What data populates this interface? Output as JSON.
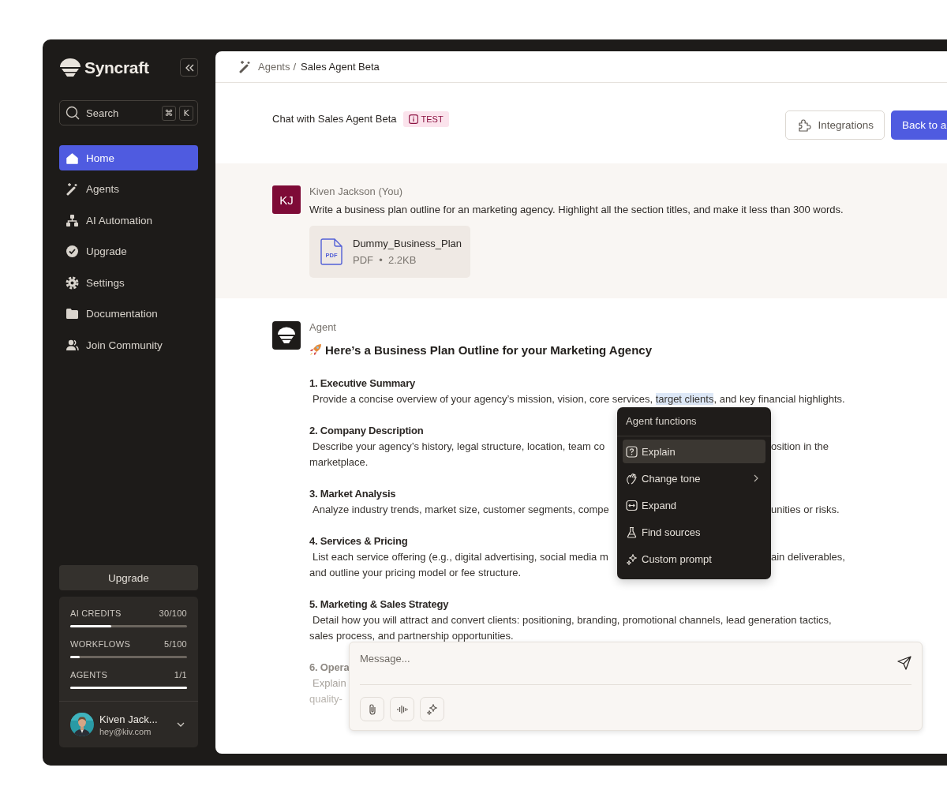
{
  "sidebar": {
    "brand": "Syncraft",
    "search": {
      "placeholder": "Search",
      "shortcut_keys": [
        "⌘",
        "K"
      ]
    },
    "nav": [
      {
        "label": "Home",
        "selected": true
      },
      {
        "label": "Agents",
        "selected": false
      },
      {
        "label": "AI Automation",
        "selected": false
      },
      {
        "label": "Upgrade",
        "selected": false
      },
      {
        "label": "Settings",
        "selected": false
      },
      {
        "label": "Documentation",
        "selected": false
      },
      {
        "label": "Join Community",
        "selected": false
      }
    ],
    "upgrade_button": "Upgrade",
    "usage": [
      {
        "label": "AI CREDITS",
        "value": "30/100",
        "level": 0.35
      },
      {
        "label": "WORKFLOWS",
        "value": "5/100",
        "level": 0.08
      },
      {
        "label": "AGENTS",
        "value": "1/1",
        "level": 1
      }
    ],
    "user": {
      "name": "Kiven Jack...",
      "email": "hey@kiv.com"
    }
  },
  "breadcrumb": {
    "parent": "Agents",
    "separator": "/",
    "current": "Sales Agent Beta"
  },
  "chat_header": {
    "title": "Chat with Sales Agent Beta",
    "badge": "TEST",
    "buttons": [
      {
        "label": "Integrations",
        "kind": "secondary"
      },
      {
        "label": "Back to a",
        "kind": "primary"
      }
    ]
  },
  "messages": [
    {
      "kind": "user",
      "initials": "KJ",
      "author": "Kiven Jackson (You)",
      "text": "Write a business plan outline for an marketing agency. Highlight all the section titles, and make it less than 300 words.",
      "attachment": {
        "name": "Dummy_Business_Plan",
        "icon_label": "PDF",
        "meta": "PDF  •  2.2KB"
      }
    },
    {
      "kind": "agent",
      "author": "Agent",
      "title": "Here’s a Business Plan Outline for your Marketing Agency",
      "sections": [
        {
          "heading": "1. Executive Summary",
          "faded": false,
          "lines": [
            {
              "segments": [
                {
                  "text": "Provide a concise overview of your agency’s mission, vision, core services, ",
                  "selected": false
                },
                {
                  "text": "target clients",
                  "selected": true
                },
                {
                  "text": ", and key financial highlights.",
                  "selected": false
                }
              ]
            }
          ]
        },
        {
          "heading": "2. Company Description",
          "faded": false,
          "lines": [
            {
              "segments": [
                {
                  "text": "Describe your agency’s history, legal structure, location, team co",
                  "selected": false
                }
              ],
              "after_menu": "osition in the"
            },
            {
              "segments": [
                {
                  "text": "marketplace.",
                  "selected": false
                }
              ]
            }
          ]
        },
        {
          "heading": "3. Market Analysis",
          "faded": false,
          "lines": [
            {
              "segments": [
                {
                  "text": "Analyze industry trends, market size, customer segments, compe",
                  "selected": false
                }
              ],
              "after_menu": "unities or risks."
            }
          ]
        },
        {
          "heading": "4. Services & Pricing",
          "faded": false,
          "lines": [
            {
              "segments": [
                {
                  "text": "List each service offering (e.g., digital advertising, social media m",
                  "selected": false
                }
              ],
              "after_menu": "ain deliverables,"
            },
            {
              "segments": [
                {
                  "text": "and outline your pricing model or fee structure.",
                  "selected": false
                }
              ]
            }
          ]
        },
        {
          "heading": "5. Marketing & Sales Strategy",
          "faded": false,
          "lines": [
            {
              "segments": [
                {
                  "text": "Detail how you will attract and convert clients: positioning, branding, promotional channels, lead generation tactics,",
                  "selected": false
                }
              ]
            },
            {
              "segments": [
                {
                  "text": "sales process, and partnership opportunities.",
                  "selected": false
                }
              ]
            }
          ]
        },
        {
          "heading": "6. Opera",
          "faded": true,
          "lines": [
            {
              "segments": [
                {
                  "text": "Explain",
                  "selected": false
                }
              ]
            },
            {
              "segments": [
                {
                  "text": "quality-",
                  "selected": false
                }
              ]
            }
          ]
        }
      ]
    }
  ],
  "context_menu": {
    "title": "Agent functions",
    "items": [
      {
        "label": "Explain",
        "selected": true,
        "submenu": false
      },
      {
        "label": "Change tone",
        "selected": false,
        "submenu": true
      },
      {
        "label": "Expand",
        "selected": false,
        "submenu": false
      },
      {
        "label": "Find sources",
        "selected": false,
        "submenu": false
      },
      {
        "label": "Custom prompt",
        "selected": false,
        "submenu": false
      }
    ]
  },
  "composer": {
    "placeholder": "Message..."
  }
}
